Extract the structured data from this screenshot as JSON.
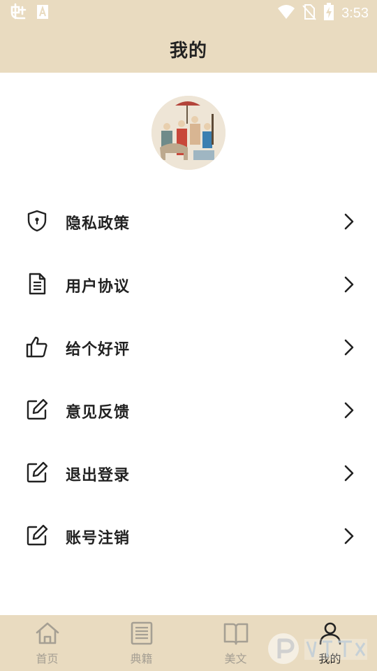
{
  "status_bar": {
    "time": "3:53",
    "left_icons": [
      "app-notification-icon",
      "font-a-icon"
    ],
    "right_icons": [
      "wifi-icon",
      "no-sim-icon",
      "battery-charging-icon"
    ]
  },
  "header": {
    "title": "我的"
  },
  "profile": {
    "avatar": "avatar-painting"
  },
  "menu": {
    "items": [
      {
        "label": "隐私政策",
        "icon": "shield-icon"
      },
      {
        "label": "用户协议",
        "icon": "document-icon"
      },
      {
        "label": "给个好评",
        "icon": "thumbs-up-icon"
      },
      {
        "label": "意见反馈",
        "icon": "edit-icon"
      },
      {
        "label": "退出登录",
        "icon": "edit-icon"
      },
      {
        "label": "账号注销",
        "icon": "edit-icon"
      }
    ]
  },
  "bottom_nav": {
    "items": [
      {
        "label": "首页",
        "icon": "home-icon",
        "active": false
      },
      {
        "label": "典籍",
        "icon": "list-icon",
        "active": false
      },
      {
        "label": "美文",
        "icon": "book-icon",
        "active": false
      },
      {
        "label": "我的",
        "icon": "user-icon",
        "active": true
      }
    ]
  },
  "colors": {
    "header_bg": "#e9dbc0",
    "text_primary": "#222222",
    "nav_inactive": "#a59f93"
  }
}
